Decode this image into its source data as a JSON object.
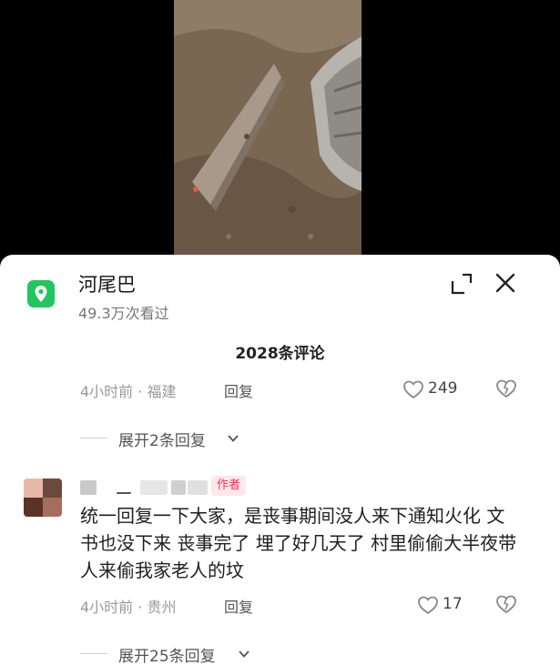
{
  "location": {
    "name": "河尾巴",
    "views": "49.3万次看过"
  },
  "comments_header": {
    "count_label": "2028条评论"
  },
  "comments": [
    {
      "meta": "4小时前 · 福建",
      "reply_label": "回复",
      "likes": "249",
      "expand_label": "展开2条回复"
    },
    {
      "author_badge": "作者",
      "text": "统一回复一下大家，是丧事期间没人来下通知火化 文书也没下来 丧事完了 埋了好几天了 村里偷偷大半夜带人来偷我家老人的坟",
      "meta": "4小时前 · 贵州",
      "reply_label": "回复",
      "likes": "17",
      "expand_label": "展开25条回复"
    }
  ],
  "colors": {
    "location_icon": "#22c55e",
    "author_badge_text": "#fe2c55",
    "author_badge_bg": "#fde8ec"
  }
}
